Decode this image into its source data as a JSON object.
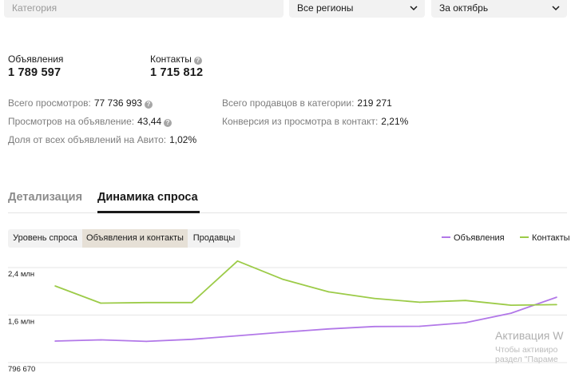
{
  "filters": {
    "category_placeholder": "Категория",
    "region": "Все регионы",
    "period": "За октябрь"
  },
  "metrics": {
    "ads_label": "Объявления",
    "ads_value": "1 789 597",
    "contacts_label": "Контакты",
    "contacts_value": "1 715 812"
  },
  "stats": {
    "views_label": "Всего просмотров:",
    "views_value": "77 736 993",
    "views_per_ad_label": "Просмотров на объявление:",
    "views_per_ad_value": "43,44",
    "share_label": "Доля от всех объявлений на Авито:",
    "share_value": "1,02%",
    "sellers_label": "Всего продавцов в категории:",
    "sellers_value": "219 271",
    "conversion_label": "Конверсия из просмотра в контакт:",
    "conversion_value": "2,21%"
  },
  "tabs": {
    "detail": "Детализация",
    "demand": "Динамика спроса"
  },
  "segments": {
    "level": "Уровень спроса",
    "ads_contacts": "Объявления и контакты",
    "sellers": "Продавцы"
  },
  "legend": {
    "ads": "Объявления",
    "contacts": "Контакты"
  },
  "info_glyph": "?",
  "colors": {
    "ads": "#b278e8",
    "contacts": "#9ccb48",
    "grid": "#e5e5e5"
  },
  "chart_data": {
    "type": "line",
    "y_ticks": [
      "2,4 млн",
      "1,6 млн",
      "796 670"
    ],
    "y_tick_values": [
      2400000,
      1600000,
      796670
    ],
    "ylim": [
      796670,
      2400000
    ],
    "grid": true,
    "legend_position": "top-right",
    "series": [
      {
        "name": "Объявления",
        "color": "#b278e8",
        "values": [
          1160000,
          1180000,
          1155000,
          1190000,
          1250000,
          1310000,
          1365000,
          1405000,
          1410000,
          1470000,
          1630000,
          1900000
        ]
      },
      {
        "name": "Контакты",
        "color": "#9ccb48",
        "values": [
          2090000,
          1800000,
          1810000,
          1810000,
          2510000,
          2200000,
          1990000,
          1880000,
          1815000,
          1845000,
          1765000,
          1775000
        ]
      }
    ]
  },
  "watermark": {
    "title": "Активация W",
    "line1": "Чтобы активиро",
    "line2": "раздел \"Параме"
  }
}
